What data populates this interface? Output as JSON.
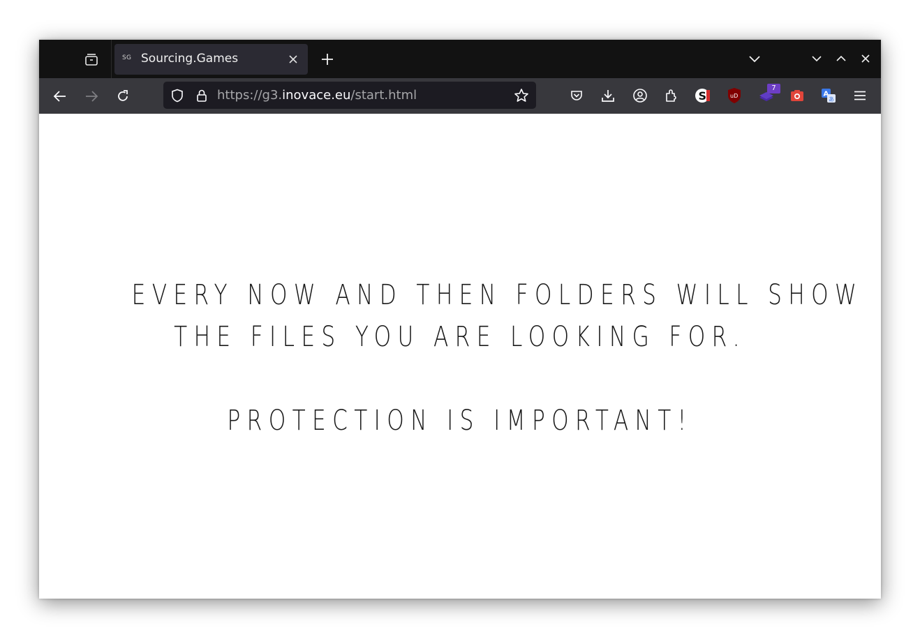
{
  "browser": {
    "tab": {
      "favicon_text": "SG",
      "title": "Sourcing.Games"
    },
    "url": {
      "scheme_prefix": "https://g3.",
      "host": "inovace.eu",
      "path": "/start.html"
    },
    "toolbar": {
      "extension_badge": "7"
    },
    "icons": {
      "tab_overview": "tab-overview-icon",
      "close_tab": "close-icon",
      "new_tab": "plus-icon",
      "list_all_tabs": "chevron-down-icon",
      "minimize": "minimize-icon",
      "maximize": "maximize-icon",
      "close_window": "close-icon",
      "back": "arrow-left-icon",
      "forward": "arrow-right-icon",
      "reload": "reload-icon",
      "shield": "shield-icon",
      "lock": "lock-icon",
      "star": "star-icon",
      "pocket": "pocket-icon",
      "downloads": "download-icon",
      "account": "account-icon",
      "extensions": "puzzle-icon",
      "menu": "hamburger-menu-icon"
    }
  },
  "page": {
    "line1": "EVERY NOW AND THEN FOLDERS WILL SHOW",
    "line2": "THE FILES YOU ARE LOOKING FOR.",
    "line3": "PROTECTION IS IMPORTANT!"
  },
  "colors": {
    "tabbar_bg": "#121212",
    "toolbar_bg": "#38383d",
    "urlbar_bg": "#1c1b22",
    "active_tab_bg": "#2b2a33",
    "text_dark": "#1a1a1a"
  }
}
